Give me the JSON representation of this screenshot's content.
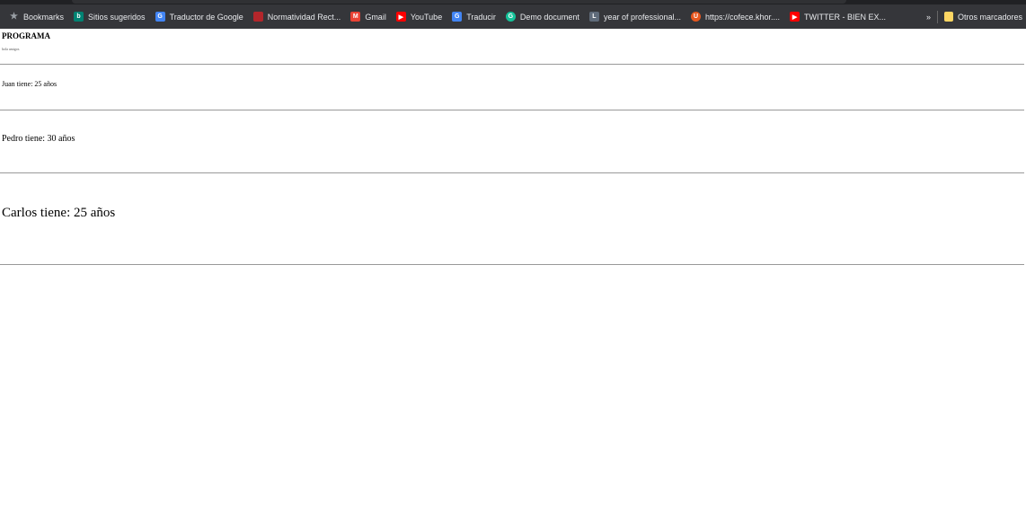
{
  "bookmarks": [
    {
      "label": "Bookmarks",
      "icon": "star-icon",
      "color": "#9aa0a6"
    },
    {
      "label": "Sitios sugeridos",
      "icon": "bing-icon",
      "color": "#008373"
    },
    {
      "label": "Traductor de Google",
      "icon": "google-translate-icon",
      "color": "#4285f4"
    },
    {
      "label": "Normatividad Rect...",
      "icon": "normatividad-icon",
      "color": "#b3262b"
    },
    {
      "label": "Gmail",
      "icon": "gmail-icon",
      "color": "#ea4335"
    },
    {
      "label": "YouTube",
      "icon": "youtube-icon",
      "color": "#ff0000"
    },
    {
      "label": "Traducir",
      "icon": "google-translate-icon",
      "color": "#4285f4"
    },
    {
      "label": "Demo document",
      "icon": "grammarly-icon",
      "color": "#15c39a"
    },
    {
      "label": "year of professional...",
      "icon": "script-l-icon",
      "color": "#5f6b7a"
    },
    {
      "label": "https://cofece.khor....",
      "icon": "u-icon",
      "color": "#e8571e"
    },
    {
      "label": "TWITTER - BIEN EX...",
      "icon": "youtube-icon",
      "color": "#ff0000"
    }
  ],
  "overflow_label": "»",
  "other_bookmarks": "Otros marcadores",
  "page": {
    "title": "PROGRAMA",
    "subtitle": "hola amigos",
    "lines": [
      "Juan tiene: 25 años",
      "Pedro tiene: 30 años",
      "Carlos tiene: 25 años"
    ]
  }
}
